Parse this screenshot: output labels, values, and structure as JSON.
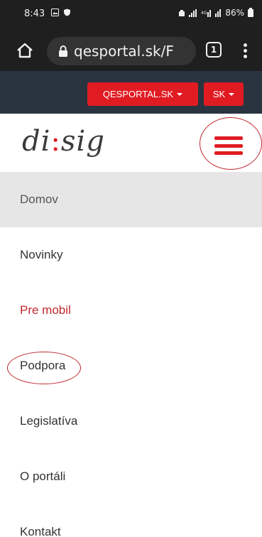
{
  "status_bar": {
    "time": "8:43",
    "right_text": "86%"
  },
  "browser": {
    "url": "qesportal.sk/F",
    "tab_count": "1"
  },
  "topbar": {
    "portal_button": "QESPORTAL.SK",
    "lang_button": "SK"
  },
  "logo": {
    "part1": "di",
    "colon": ":",
    "part2": "sig"
  },
  "colors": {
    "accent": "#e01b22",
    "topbar_bg": "#2a3440",
    "chrome_bg": "#1f1f1f"
  },
  "menu": {
    "items": [
      {
        "label": "Domov"
      },
      {
        "label": "Novinky"
      },
      {
        "label": "Pre mobil"
      },
      {
        "label": "Podpora"
      },
      {
        "label": "Legislatíva"
      },
      {
        "label": "O portáli"
      },
      {
        "label": "Kontakt"
      }
    ]
  }
}
